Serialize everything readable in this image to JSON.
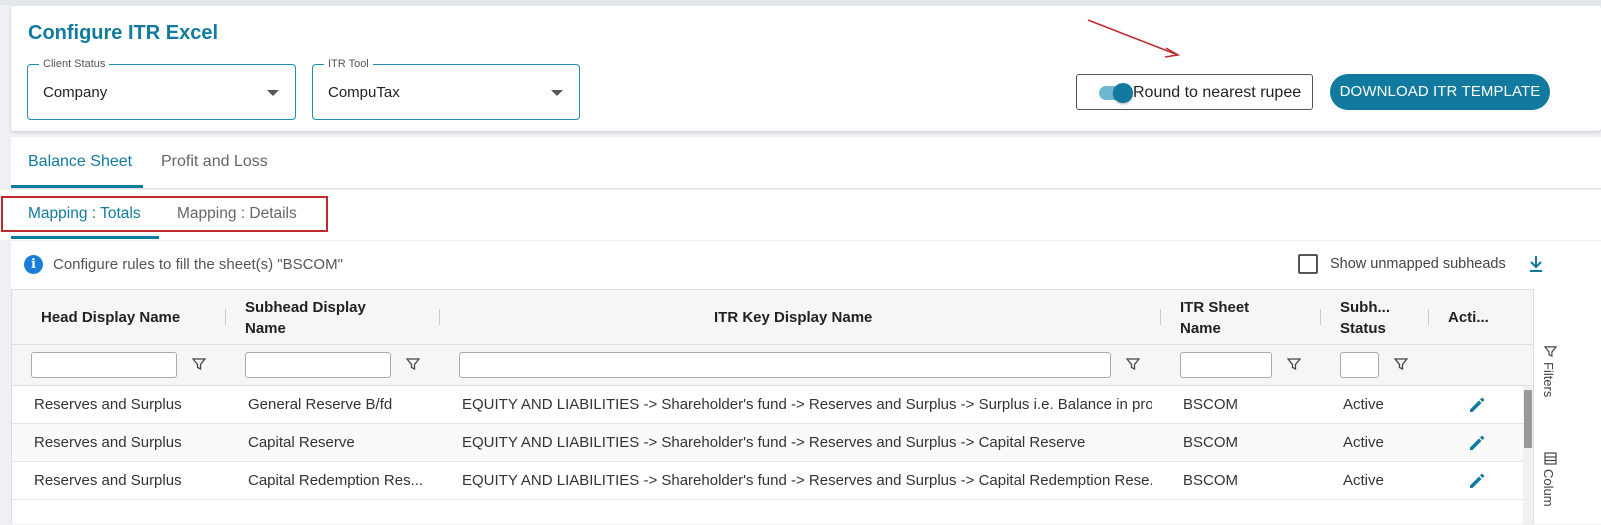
{
  "header": {
    "title": "Configure ITR Excel",
    "client_status": {
      "label": "Client Status",
      "value": "Company"
    },
    "itr_tool": {
      "label": "ITR Tool",
      "value": "CompuTax"
    },
    "round_toggle_label": "Round to nearest rupee",
    "round_toggle_on": true,
    "download_button": "DOWNLOAD ITR TEMPLATE"
  },
  "tabs": [
    {
      "label": "Balance Sheet",
      "active": true
    },
    {
      "label": "Profit and Loss",
      "active": false
    }
  ],
  "subtabs": [
    {
      "label": "Mapping : Totals",
      "active": true
    },
    {
      "label": "Mapping : Details",
      "active": false
    }
  ],
  "info": {
    "text": "Configure rules to fill the sheet(s) \"BSCOM\"",
    "show_unmapped_label": "Show unmapped subheads",
    "show_unmapped_checked": false
  },
  "grid": {
    "columns": [
      "Head Display Name",
      "Subhead Display Name",
      "ITR Key Display Name",
      "ITR Sheet Name",
      "Subh... Status",
      "Acti..."
    ],
    "rows": [
      [
        "Reserves and Surplus",
        "General Reserve B/fd",
        "EQUITY AND LIABILITIES -> Shareholder's fund -> Reserves and Surplus -> Surplus i.e. Balance in pro...",
        "BSCOM",
        "Active"
      ],
      [
        "Reserves and Surplus",
        "Capital Reserve",
        "EQUITY AND LIABILITIES -> Shareholder's fund -> Reserves and Surplus -> Capital Reserve",
        "BSCOM",
        "Active"
      ],
      [
        "Reserves and Surplus",
        "Capital Redemption Res...",
        "EQUITY AND LIABILITIES -> Shareholder's fund -> Reserves and Surplus -> Capital Redemption Rese...",
        "BSCOM",
        "Active"
      ]
    ]
  },
  "side_panel": {
    "filters": "Filters",
    "columns": "Colum"
  },
  "colors": {
    "accent": "#117a9e",
    "highlight": "#c0282a",
    "info": "#1a7ed8"
  }
}
